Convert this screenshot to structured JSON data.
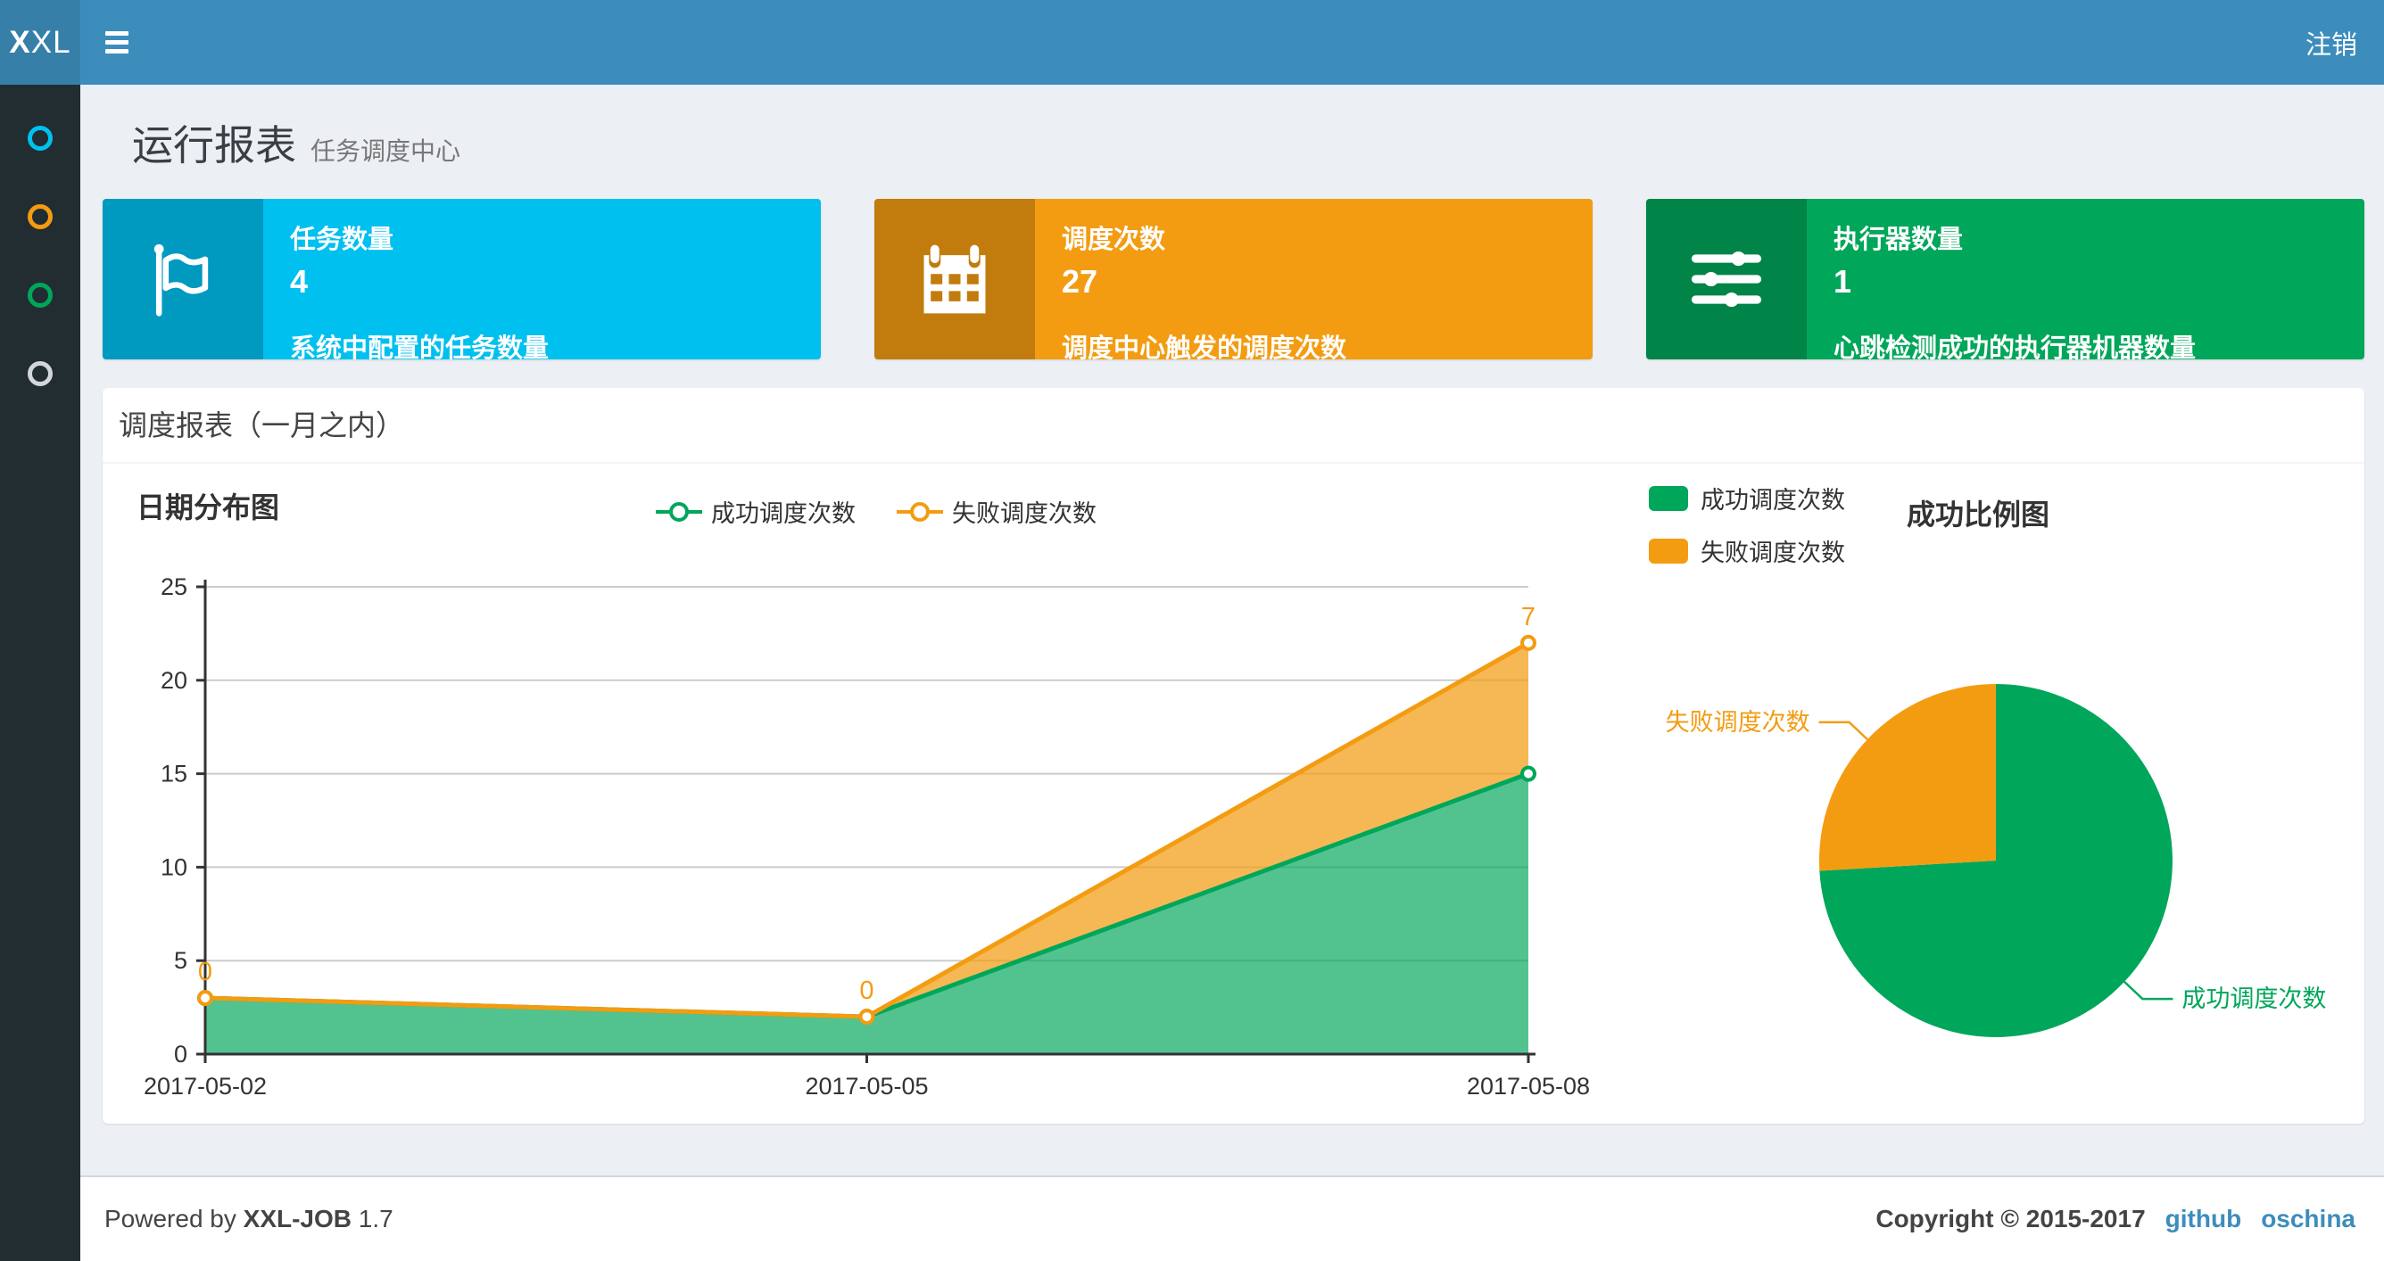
{
  "navbar": {
    "logo_bold": "X",
    "logo_light": "XL",
    "logout": "注销"
  },
  "sidebar": {
    "items": [
      {
        "name": "sidebar-item-1",
        "color": "#00c0ef"
      },
      {
        "name": "sidebar-item-2",
        "color": "#f39c12"
      },
      {
        "name": "sidebar-item-3",
        "color": "#00a65a"
      },
      {
        "name": "sidebar-item-4",
        "color": "#d2d6de"
      }
    ]
  },
  "page": {
    "title": "运行报表",
    "subtitle": "任务调度中心"
  },
  "info_boxes": [
    {
      "label": "任务数量",
      "value": "4",
      "desc": "系统中配置的任务数量",
      "color": "#00c0ef",
      "icon": "flag-icon"
    },
    {
      "label": "调度次数",
      "value": "27",
      "desc": "调度中心触发的调度次数",
      "color": "#f39c12",
      "icon": "calendar-icon"
    },
    {
      "label": "执行器数量",
      "value": "1",
      "desc": "心跳检测成功的执行器机器数量",
      "color": "#00a65a",
      "icon": "sliders-icon"
    }
  ],
  "panel": {
    "title": "调度报表（一月之内）"
  },
  "chart_data": [
    {
      "type": "area",
      "name": "日期分布图",
      "categories": [
        "2017-05-02",
        "2017-05-05",
        "2017-05-08"
      ],
      "series": [
        {
          "name": "成功调度次数",
          "color": "#00a65a",
          "values": [
            3,
            2,
            15
          ]
        },
        {
          "name": "失败调度次数",
          "color": "#f39c12",
          "values": [
            0,
            0,
            7
          ],
          "point_labels": [
            "0",
            "0",
            "7"
          ]
        }
      ],
      "stacked": true,
      "ylim": [
        0,
        25
      ],
      "ytick_step": 5,
      "grid": "horizontal",
      "legend_position": "top-center"
    },
    {
      "type": "pie",
      "name": "成功比例图",
      "slices": [
        {
          "name": "成功调度次数",
          "value": 20,
          "color": "#00a65a"
        },
        {
          "name": "失败调度次数",
          "value": 7,
          "color": "#f39c12"
        }
      ],
      "legend_position": "top-left"
    }
  ],
  "footer": {
    "powered_prefix": "Powered by",
    "product": "XXL-JOB",
    "version": "1.7",
    "copyright": "Copyright © 2015-2017",
    "links": [
      "github",
      "oschina"
    ]
  }
}
